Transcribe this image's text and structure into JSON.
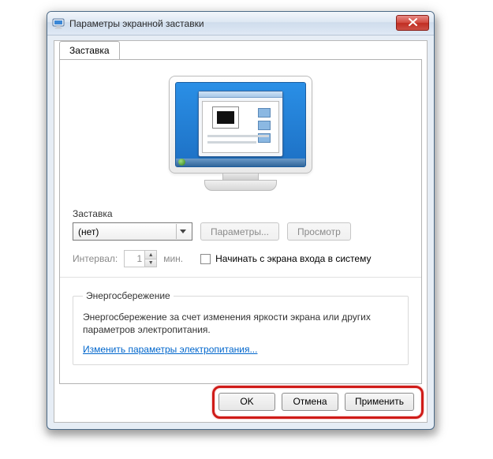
{
  "window": {
    "title": "Параметры экранной заставки"
  },
  "tab": {
    "label": "Заставка"
  },
  "screensaver": {
    "group_label": "Заставка",
    "selected": "(нет)",
    "settings_btn": "Параметры...",
    "preview_btn": "Просмотр",
    "interval_label": "Интервал:",
    "interval_value": "1",
    "interval_unit": "мин.",
    "resume_label": "Начинать с экрана входа в систему"
  },
  "energy": {
    "legend": "Энергосбережение",
    "text": "Энергосбережение за счет изменения яркости экрана или других параметров электропитания.",
    "link": "Изменить параметры электропитания..."
  },
  "buttons": {
    "ok": "OK",
    "cancel": "Отмена",
    "apply": "Применить"
  }
}
